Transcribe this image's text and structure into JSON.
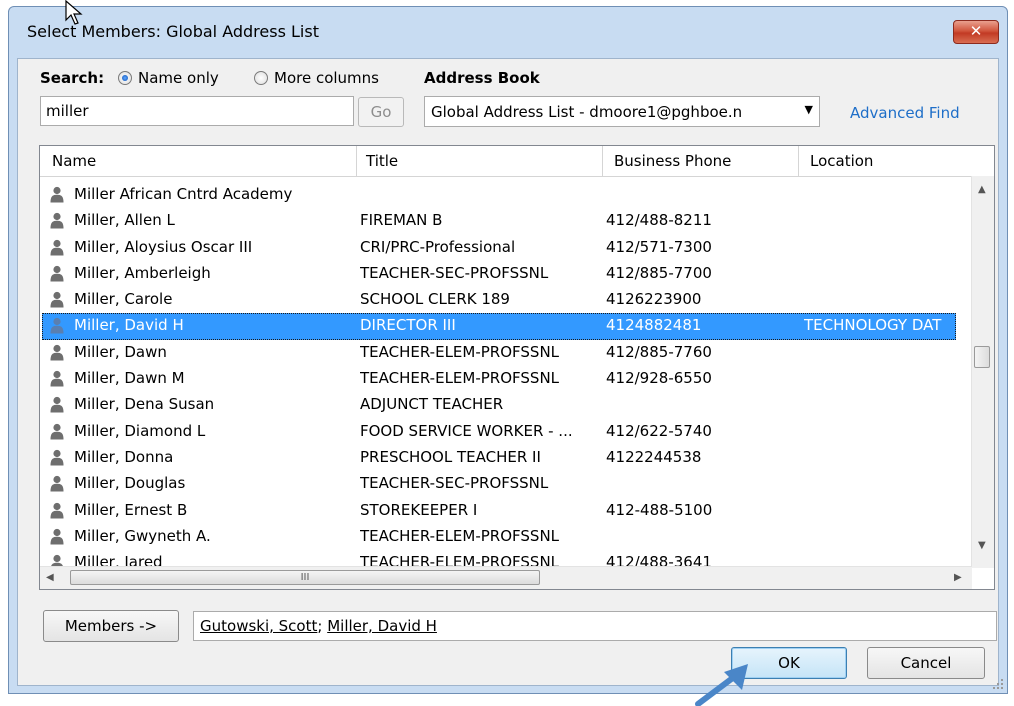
{
  "window": {
    "title": "Select Members: Global Address List",
    "close_label": "✕"
  },
  "search": {
    "label": "Search:",
    "option_name_only": "Name only",
    "option_more_columns": "More columns",
    "selected_option": "Name only",
    "value": "miller",
    "go_label": "Go"
  },
  "address_book": {
    "label": "Address Book",
    "selected": "Global Address List - dmoore1@pghboe.n",
    "advanced_find": "Advanced Find"
  },
  "list": {
    "columns": [
      "Name",
      "Title",
      "Business Phone",
      "Location"
    ],
    "rows": [
      {
        "name": "Miller African Cntrd Academy",
        "title": "",
        "phone": "",
        "location": "",
        "selected": false
      },
      {
        "name": "Miller, Allen L",
        "title": "FIREMAN B",
        "phone": "412/488-8211",
        "location": "",
        "selected": false
      },
      {
        "name": "Miller, Aloysius Oscar III",
        "title": "CRI/PRC-Professional",
        "phone": "412/571-7300",
        "location": "",
        "selected": false
      },
      {
        "name": "Miller, Amberleigh",
        "title": "TEACHER-SEC-PROFSSNL",
        "phone": "412/885-7700",
        "location": "",
        "selected": false
      },
      {
        "name": "Miller, Carole",
        "title": "SCHOOL CLERK 189",
        "phone": "4126223900",
        "location": "",
        "selected": false
      },
      {
        "name": "Miller, David H",
        "title": "DIRECTOR III",
        "phone": "4124882481",
        "location": "TECHNOLOGY DAT",
        "selected": true
      },
      {
        "name": "Miller, Dawn",
        "title": "TEACHER-ELEM-PROFSSNL",
        "phone": "412/885-7760",
        "location": "",
        "selected": false
      },
      {
        "name": "Miller, Dawn M",
        "title": "TEACHER-ELEM-PROFSSNL",
        "phone": "412/928-6550",
        "location": "",
        "selected": false
      },
      {
        "name": "Miller, Dena Susan",
        "title": "ADJUNCT TEACHER",
        "phone": "",
        "location": "",
        "selected": false
      },
      {
        "name": "Miller, Diamond L",
        "title": "FOOD SERVICE WORKER - ...",
        "phone": "412/622-5740",
        "location": "",
        "selected": false
      },
      {
        "name": "Miller, Donna",
        "title": "PRESCHOOL TEACHER II",
        "phone": "4122244538",
        "location": "",
        "selected": false
      },
      {
        "name": "Miller, Douglas",
        "title": "TEACHER-SEC-PROFSSNL",
        "phone": "",
        "location": "",
        "selected": false
      },
      {
        "name": "Miller, Ernest B",
        "title": "STOREKEEPER I",
        "phone": "412-488-5100",
        "location": "",
        "selected": false
      },
      {
        "name": "Miller, Gwyneth A.",
        "title": "TEACHER-ELEM-PROFSSNL",
        "phone": "",
        "location": "",
        "selected": false
      },
      {
        "name": "Miller, Jared",
        "title": "TEACHER-ELEM-PROFSSNL",
        "phone": "412/488-3641",
        "location": "",
        "selected": false
      }
    ],
    "hscroll_grip": "III"
  },
  "members": {
    "button_label": "Members ->",
    "items": [
      "Gutowski, Scott",
      "Miller, David H"
    ],
    "separator": "; "
  },
  "buttons": {
    "ok": "OK",
    "cancel": "Cancel"
  },
  "colors": {
    "selection": "#3399ff",
    "link": "#1e6ec8",
    "frame": "#c8dcf2",
    "annotation_arrow": "#4a86c8"
  },
  "icons": {
    "person": "person-icon",
    "close": "close-icon",
    "dropdown": "chevron-down-icon",
    "pointer": "mouse-pointer-icon",
    "annotation": "annotation-arrow-icon"
  }
}
